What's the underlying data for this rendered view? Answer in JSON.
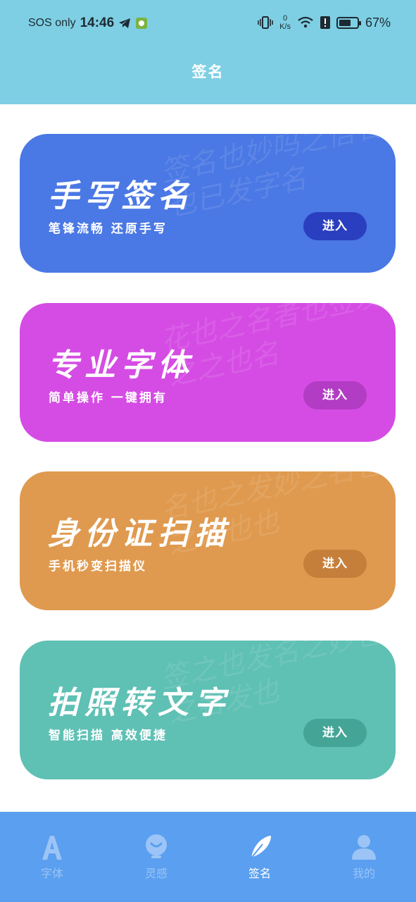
{
  "status_bar": {
    "carrier": "SOS only",
    "time": "14:46",
    "speed_value": "0",
    "speed_unit": "K/s",
    "battery": "67%",
    "battery_level": 0.67
  },
  "header": {
    "title": "签名"
  },
  "cards": [
    {
      "title": "手写签名",
      "subtitle": "笔锋流畅  还原手写",
      "button": "进入",
      "color": "#4a78e4",
      "button_color": "#2a3fbf",
      "bg_text": "签名也妙吗之信名也已发字名"
    },
    {
      "title": "专业字体",
      "subtitle": "简单操作  一键拥有",
      "button": "进入",
      "color": "#d54ce4",
      "button_color": "#b23cc3",
      "bg_text": "花也之名者也签发之之也名"
    },
    {
      "title": "身份证扫描",
      "subtitle": "手机秒变扫描仪",
      "button": "进入",
      "color": "#df9a4f",
      "button_color": "#c67f3a",
      "bg_text": "名也之发妙之名也之发也也"
    },
    {
      "title": "拍照转文字",
      "subtitle": "智能扫描  高效便捷",
      "button": "进入",
      "color": "#5fc0b4",
      "button_color": "#44a596",
      "bg_text": "签之也发名之妙也之名发也"
    }
  ],
  "bottom_nav": [
    {
      "label": "字体",
      "icon": "letter-a-icon",
      "active": false
    },
    {
      "label": "灵感",
      "icon": "lightbulb-icon",
      "active": false
    },
    {
      "label": "签名",
      "icon": "feather-icon",
      "active": true
    },
    {
      "label": "我的",
      "icon": "person-icon",
      "active": false
    }
  ]
}
